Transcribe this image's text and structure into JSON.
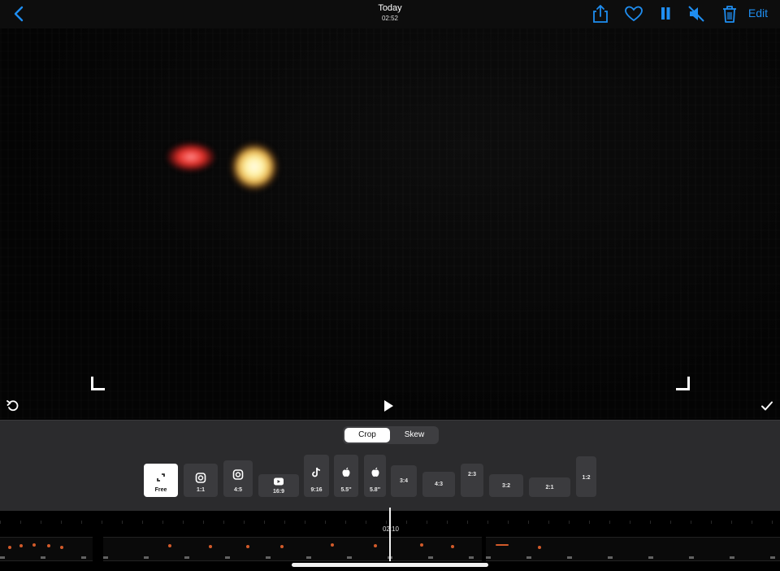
{
  "header": {
    "title": "Today",
    "subtitle": "02:52",
    "edit_label": "Edit",
    "icons": [
      "back-chevron-icon",
      "share-icon",
      "heart-icon",
      "pause-icon",
      "mute-icon",
      "trash-icon"
    ],
    "accent_color": "#1f8ef1"
  },
  "viewer": {
    "icons": [
      "rotate-icon",
      "play-icon",
      "checkmark-icon"
    ]
  },
  "tools": {
    "tabs": [
      {
        "label": "Crop",
        "active": true
      },
      {
        "label": "Skew",
        "active": false
      }
    ],
    "ratios": [
      {
        "label": "Free",
        "icon": "expand-icon",
        "selected": true
      },
      {
        "label": "1:1",
        "icon": "instagram-icon"
      },
      {
        "label": "4:5",
        "icon": "instagram-icon"
      },
      {
        "label": "16:9",
        "icon": "youtube-icon"
      },
      {
        "label": "9:16",
        "icon": "tiktok-icon"
      },
      {
        "label": "5.5''",
        "icon": "apple-icon"
      },
      {
        "label": "5.8''",
        "icon": "apple-icon"
      },
      {
        "label": "3:4"
      },
      {
        "label": "4:3"
      },
      {
        "label": "2:3"
      },
      {
        "label": "3:2"
      },
      {
        "label": "2:1"
      },
      {
        "label": "1:2"
      }
    ]
  },
  "timeline": {
    "time_label": "02:10"
  }
}
